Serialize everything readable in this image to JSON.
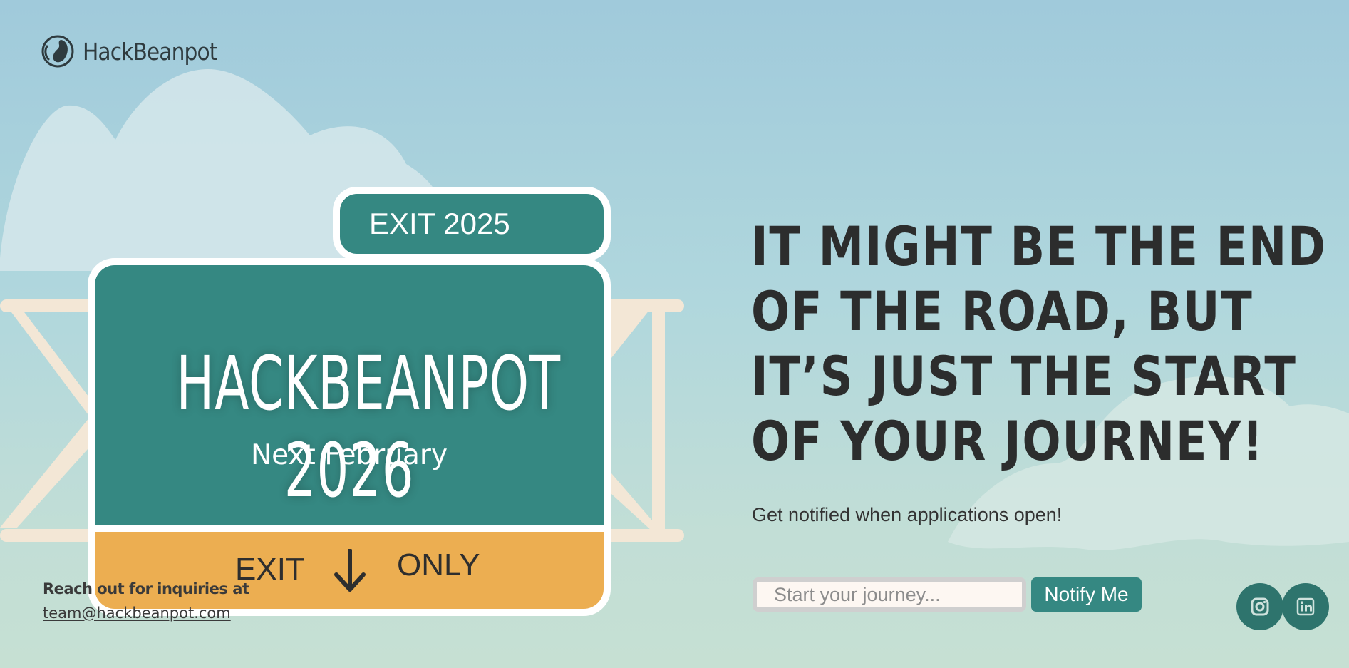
{
  "brand": {
    "name": "HackBeanpot",
    "logo_icon": "bean-logo-icon"
  },
  "sign": {
    "exit_tab": "EXIT 2025",
    "title": "HACKBEANPOT 2026",
    "subtitle": "Next February",
    "exit_label": "EXIT",
    "only_label": "ONLY",
    "arrow_icon": "arrow-down-icon"
  },
  "hero": {
    "lines": [
      "IT MIGHT BE THE END",
      "OF THE ROAD, BUT",
      "IT’S JUST THE START",
      "OF YOUR JOURNEY!"
    ],
    "notify_text": "Get notified when applications open!"
  },
  "form": {
    "placeholder": "Start your journey...",
    "button_label": "Notify Me"
  },
  "contact": {
    "label": "Reach out for inquiries at",
    "email": "team@hackbeanpot.com"
  },
  "social": [
    {
      "icon": "instagram-icon"
    },
    {
      "icon": "linkedin-icon"
    }
  ],
  "colors": {
    "sign_green": "#358882",
    "sign_yellow": "#ecae51",
    "text_dark": "#2c2d2d",
    "social_green": "#2e746d"
  }
}
